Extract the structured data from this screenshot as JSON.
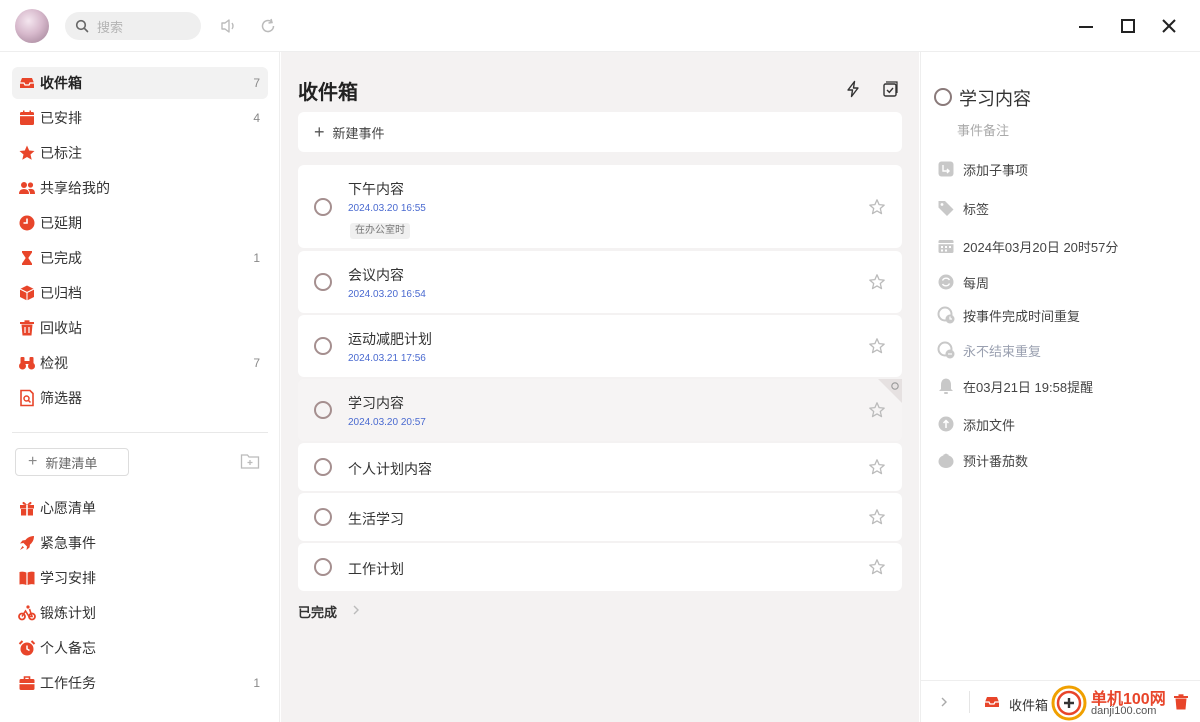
{
  "colors": {
    "accent": "#e8452a",
    "date_blue": "#4a6ad0",
    "main_bg": "#f4f2f2"
  },
  "search": {
    "placeholder": "搜索"
  },
  "sidebar": {
    "items": [
      {
        "label": "收件箱",
        "count": "7",
        "icon": "inbox-icon"
      },
      {
        "label": "已安排",
        "count": "4",
        "icon": "calendar-icon"
      },
      {
        "label": "已标注",
        "count": "",
        "icon": "star-icon"
      },
      {
        "label": "共享给我的",
        "count": "",
        "icon": "people-icon"
      },
      {
        "label": "已延期",
        "count": "",
        "icon": "clock-icon"
      },
      {
        "label": "已完成",
        "count": "1",
        "icon": "hourglass-icon"
      },
      {
        "label": "已归档",
        "count": "",
        "icon": "box-icon"
      },
      {
        "label": "回收站",
        "count": "",
        "icon": "trash-icon"
      },
      {
        "label": "检视",
        "count": "7",
        "icon": "binoculars-icon"
      },
      {
        "label": "筛选器",
        "count": "",
        "icon": "filter-icon"
      }
    ],
    "new_list_label": "新建清单",
    "lists": [
      {
        "label": "心愿清单",
        "count": "",
        "icon": "gift-icon"
      },
      {
        "label": "紧急事件",
        "count": "",
        "icon": "rocket-icon"
      },
      {
        "label": "学习安排",
        "count": "",
        "icon": "book-icon"
      },
      {
        "label": "锻炼计划",
        "count": "",
        "icon": "bike-icon"
      },
      {
        "label": "个人备忘",
        "count": "",
        "icon": "alarm-icon"
      },
      {
        "label": "工作任务",
        "count": "1",
        "icon": "briefcase-icon"
      }
    ]
  },
  "main": {
    "title": "收件箱",
    "new_task_label": "新建事件",
    "tasks": [
      {
        "title": "下午内容",
        "date": "2024.03.20 16:55",
        "tag": "在办公室时"
      },
      {
        "title": "会议内容",
        "date": "2024.03.20 16:54"
      },
      {
        "title": "运动减肥计划",
        "date": "2024.03.21 17:56"
      },
      {
        "title": "学习内容",
        "date": "2024.03.20 20:57"
      },
      {
        "title": "个人计划内容"
      },
      {
        "title": "生活学习"
      },
      {
        "title": "工作计划"
      }
    ],
    "completed_label": "已完成"
  },
  "detail": {
    "title": "学习内容",
    "note_placeholder": "事件备注",
    "rows": [
      {
        "text": "添加子事项",
        "icon": "subtask-icon"
      },
      {
        "text": "标签",
        "icon": "tag-icon"
      },
      {
        "text": "2024年03月20日 20时57分",
        "icon": "calendar-icon"
      },
      {
        "text": "每周",
        "icon": "repeat-icon"
      },
      {
        "text": "按事件完成时间重复",
        "icon": "repeat-clock-icon"
      },
      {
        "text": "永不结束重复",
        "icon": "repeat-end-icon"
      },
      {
        "text": "在03月21日 19:58提醒",
        "icon": "bell-icon"
      },
      {
        "text": "添加文件",
        "icon": "attach-icon"
      },
      {
        "text": "预计番茄数",
        "icon": "tomato-icon"
      }
    ],
    "footer_list": "收件箱",
    "watermark_title": "单机100网",
    "watermark_url": "danji100.com"
  }
}
